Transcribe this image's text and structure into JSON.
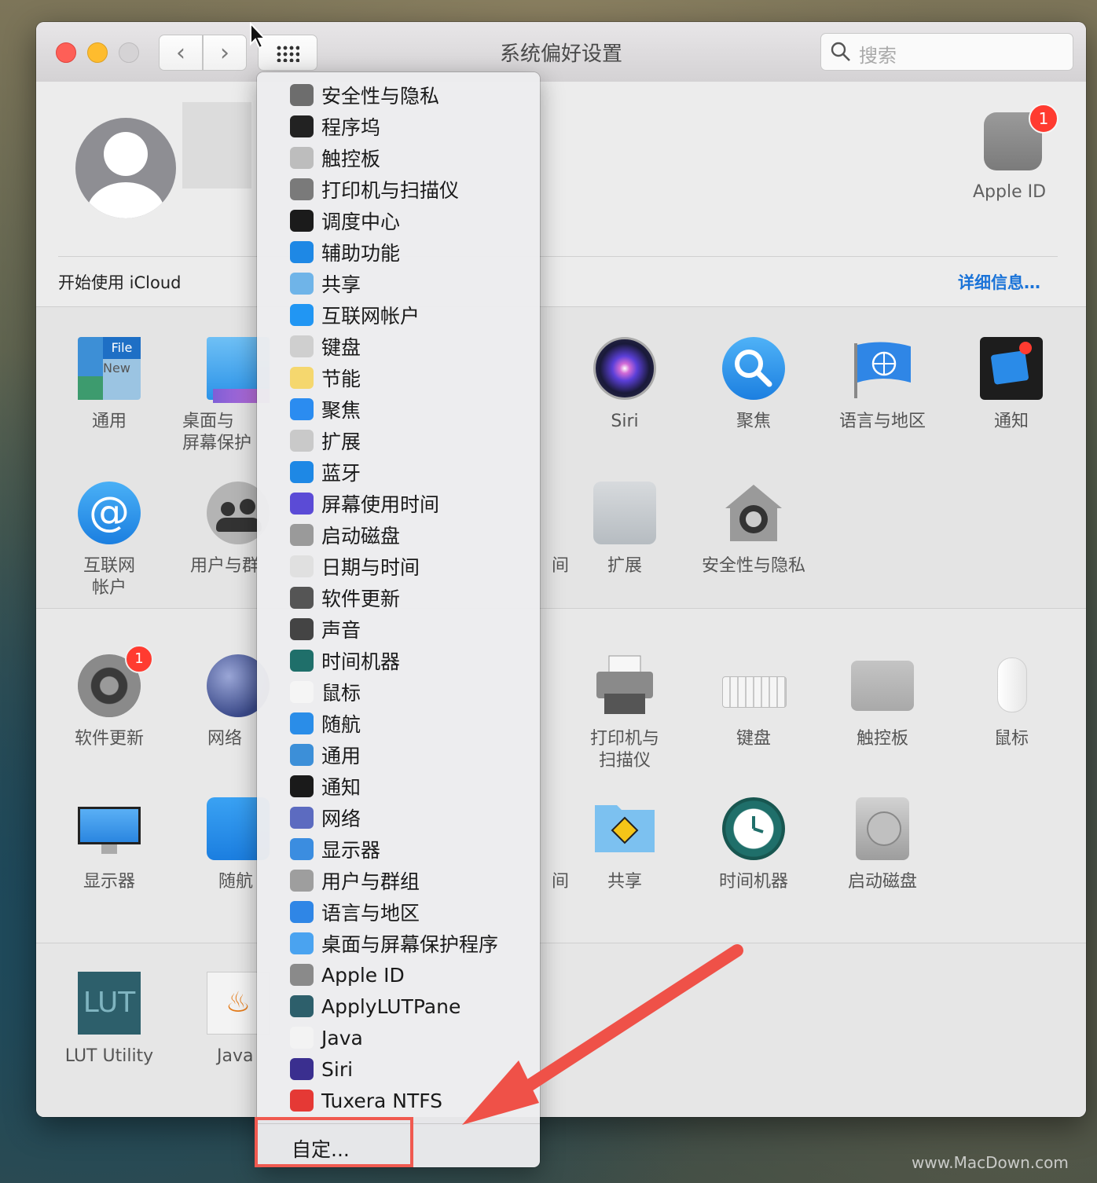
{
  "window": {
    "title": "系统偏好设置",
    "search_placeholder": "搜索"
  },
  "account": {
    "apple_id_label": "Apple ID",
    "apple_id_badge": "1",
    "icloud_text": "开始使用 iCloud",
    "details_link": "详细信息…"
  },
  "section1": {
    "row1": [
      {
        "label": "通用",
        "icon": "general-icon"
      },
      {
        "label": "桌面与\n屏幕保护",
        "icon": "desktop-icon"
      },
      {
        "label": "Siri",
        "icon": "siri-icon"
      },
      {
        "label": "聚焦",
        "icon": "spotlight-icon"
      },
      {
        "label": "语言与地区",
        "icon": "language-icon"
      },
      {
        "label": "通知",
        "icon": "notification-icon"
      }
    ],
    "row2": [
      {
        "label": "互联网\n帐户",
        "icon": "internet-accounts-icon"
      },
      {
        "label": "用户与群",
        "icon": "users-icon"
      },
      {
        "label": "间",
        "icon": "screen-time-icon"
      },
      {
        "label": "扩展",
        "icon": "extensions-icon"
      },
      {
        "label": "安全性与隐私",
        "icon": "security-icon"
      }
    ]
  },
  "section2": {
    "row1": [
      {
        "label": "软件更新",
        "icon": "software-update-icon",
        "badge": "1"
      },
      {
        "label": "网络",
        "icon": "network-icon"
      },
      {
        "label": "打印机与\n扫描仪",
        "icon": "printer-icon"
      },
      {
        "label": "键盘",
        "icon": "keyboard-icon"
      },
      {
        "label": "触控板",
        "icon": "trackpad-icon"
      },
      {
        "label": "鼠标",
        "icon": "mouse-icon"
      }
    ],
    "row2": [
      {
        "label": "显示器",
        "icon": "display-icon"
      },
      {
        "label": "随航",
        "icon": "sidecar-icon"
      },
      {
        "label": "间",
        "icon": "partial-icon"
      },
      {
        "label": "共享",
        "icon": "sharing-icon"
      },
      {
        "label": "时间机器",
        "icon": "time-machine-icon"
      },
      {
        "label": "启动磁盘",
        "icon": "startup-disk-icon"
      }
    ]
  },
  "section3": [
    {
      "label": "LUT Utility",
      "icon": "lut-icon",
      "icon_text": "LUT"
    },
    {
      "label": "Java",
      "icon": "java-icon"
    }
  ],
  "menu": {
    "items": [
      {
        "label": "安全性与隐私",
        "icon": "security-icon",
        "color": "#6d6d6d"
      },
      {
        "label": "程序坞",
        "icon": "dock-icon",
        "color": "#222222"
      },
      {
        "label": "触控板",
        "icon": "trackpad-icon",
        "color": "#bdbdbd"
      },
      {
        "label": "打印机与扫描仪",
        "icon": "printer-icon",
        "color": "#7a7a7a"
      },
      {
        "label": "调度中心",
        "icon": "mission-control-icon",
        "color": "#1b1b1b"
      },
      {
        "label": "辅助功能",
        "icon": "accessibility-icon",
        "color": "#1e88e5"
      },
      {
        "label": "共享",
        "icon": "sharing-icon",
        "color": "#6fb4e8"
      },
      {
        "label": "互联网帐户",
        "icon": "internet-accounts-icon",
        "color": "#2196f3"
      },
      {
        "label": "键盘",
        "icon": "keyboard-icon",
        "color": "#cfcfcf"
      },
      {
        "label": "节能",
        "icon": "energy-icon",
        "color": "#f5d76e"
      },
      {
        "label": "聚焦",
        "icon": "spotlight-icon",
        "color": "#2b8cf0"
      },
      {
        "label": "扩展",
        "icon": "extensions-icon",
        "color": "#c9c9c9"
      },
      {
        "label": "蓝牙",
        "icon": "bluetooth-icon",
        "color": "#1e88e5"
      },
      {
        "label": "屏幕使用时间",
        "icon": "screen-time-icon",
        "color": "#5b4bd6"
      },
      {
        "label": "启动磁盘",
        "icon": "startup-disk-icon",
        "color": "#9a9a9a"
      },
      {
        "label": "日期与时间",
        "icon": "date-time-icon",
        "color": "#e0e0e0"
      },
      {
        "label": "软件更新",
        "icon": "software-update-icon",
        "color": "#555555"
      },
      {
        "label": "声音",
        "icon": "sound-icon",
        "color": "#444444"
      },
      {
        "label": "时间机器",
        "icon": "time-machine-icon",
        "color": "#1f6f6a"
      },
      {
        "label": "鼠标",
        "icon": "mouse-icon",
        "color": "#f5f5f5"
      },
      {
        "label": "随航",
        "icon": "sidecar-icon",
        "color": "#2a8de8"
      },
      {
        "label": "通用",
        "icon": "general-icon",
        "color": "#3c8fd8"
      },
      {
        "label": "通知",
        "icon": "notification-icon",
        "color": "#1a1a1a"
      },
      {
        "label": "网络",
        "icon": "network-icon",
        "color": "#5c6bc0"
      },
      {
        "label": "显示器",
        "icon": "display-icon",
        "color": "#3b8de0"
      },
      {
        "label": "用户与群组",
        "icon": "users-icon",
        "color": "#9e9e9e"
      },
      {
        "label": "语言与地区",
        "icon": "language-icon",
        "color": "#2f86e6"
      },
      {
        "label": "桌面与屏幕保护程序",
        "icon": "desktop-icon",
        "color": "#4aa3f0"
      },
      {
        "label": "Apple ID",
        "icon": "apple-id-icon",
        "color": "#8a8a8a"
      },
      {
        "label": "ApplyLUTPane",
        "icon": "lut-icon",
        "color": "#2d5f6b"
      },
      {
        "label": "Java",
        "icon": "java-icon",
        "color": "#f3f3f3"
      },
      {
        "label": "Siri",
        "icon": "siri-icon",
        "color": "#3a2f8f"
      },
      {
        "label": "Tuxera NTFS",
        "icon": "tuxera-icon",
        "color": "#e53935"
      }
    ],
    "customize_label": "自定..."
  },
  "watermark": "www.MacDown.com"
}
